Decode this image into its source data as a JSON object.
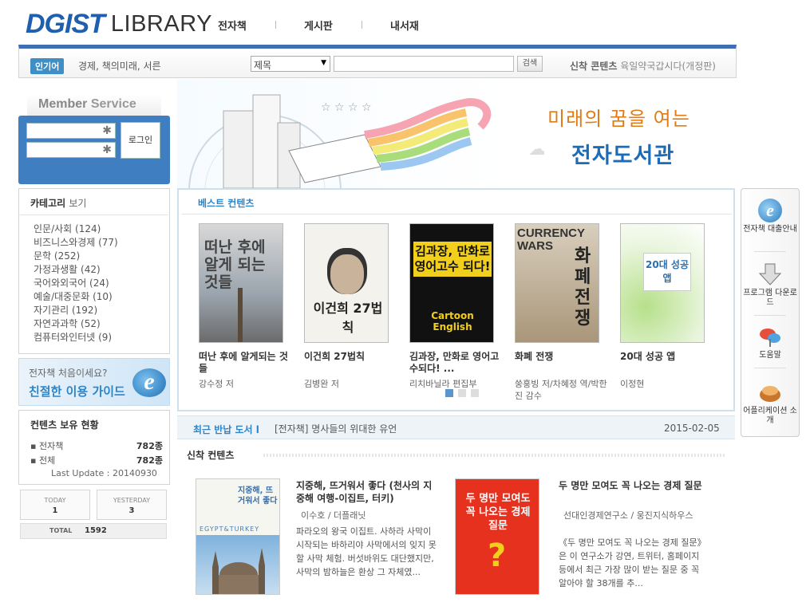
{
  "header": {
    "logo_mark": "DGIST",
    "logo_text": "LIBRARY",
    "nav": [
      "전자책",
      "게시판",
      "내서재"
    ]
  },
  "search_bar": {
    "popular_label": "인기어",
    "popular_words": "경제, 책의미래, 서른",
    "field_option": "제목",
    "search_button": "검색",
    "new_content_label": "신착 콘텐츠",
    "new_content_title": "육일약국갑시다(개정판)"
  },
  "member": {
    "title_a": "Member",
    "title_b": "Service",
    "login_button": "로그인"
  },
  "category": {
    "title": "카테고리",
    "title_suffix": "보기",
    "items": [
      "인문/사회 (124)",
      "비즈니스와경제 (77)",
      "문학 (252)",
      "가정과생활 (42)",
      "국어와외국어 (24)",
      "예술/대중문화 (10)",
      "자기관리 (192)",
      "자연과과학 (52)",
      "컴퓨터와인터넷 (9)"
    ]
  },
  "guide": {
    "line1": "전자책 처음이세요?",
    "line2": "친절한 이용 가이드",
    "icon": "e"
  },
  "holdings": {
    "title": "컨텐츠 보유 현황",
    "rows": [
      {
        "label": "전자책",
        "value": "782종"
      },
      {
        "label": "전체",
        "value": "782종"
      }
    ],
    "last_update": "Last Update : 20140930"
  },
  "stats": {
    "today_label": "TODAY",
    "today_value": "1",
    "yesterday_label": "YESTERDAY",
    "yesterday_value": "3",
    "total_label": "TOTAL",
    "total_value": "1592"
  },
  "banner": {
    "line1": "미래의 꿈을 여는",
    "line2": "전자도서관"
  },
  "best": {
    "title": "베스트 컨텐츠",
    "items": [
      {
        "title": "떠난 후에 알게되는 것들",
        "author": "강수정 저",
        "cover_text": "떠난 후에 알게 되는 것들"
      },
      {
        "title": "이건희 27법칙",
        "author": "김병완 저",
        "cover_text": "이건희 27법칙"
      },
      {
        "title": "김과장, 만화로 영어고수되다! ...",
        "author": "리치바닐라 편집부",
        "cover_text": "김과장, 만화로 영어고수 되다!",
        "cover_sub": "Cartoon English"
      },
      {
        "title": "화폐 전쟁",
        "author": "쑹훙빙 저/차혜정 역/박한진 감수",
        "cover_text": "화폐전쟁",
        "cover_sub": "CURRENCY WARS"
      },
      {
        "title": "20대 성공 앱",
        "author": "이정현",
        "cover_text": "20대 성공앱"
      }
    ],
    "page_count": 3,
    "active_page": 0
  },
  "quick_menu": [
    {
      "label": "전자책 대출안내",
      "icon": "ie-icon"
    },
    {
      "label": "프로그램 다운로드",
      "icon": "download-arrow-icon"
    },
    {
      "label": "도움말",
      "icon": "help-icon"
    },
    {
      "label": "어플리케이션 소개",
      "icon": "app-icon"
    }
  ],
  "recent_return": {
    "label": "최근 반납 도서 l",
    "title": "[전자책] 명사들의 위대한 유언",
    "date": "2015-02-05"
  },
  "new_content": {
    "title": "신착 컨텐츠",
    "items": [
      {
        "title": "지중해, 뜨거워서 좋다 (천사의 지중해 여행-이집트, 터키)",
        "author": "이수호 / 더플래닛",
        "desc": "파라오의 왕국 이집트. 사하라 사막이 시작되는 바하리야 사막에서의 잊지 못할 사막 체험. 버섯바위도 대단했지만, 사막의 밤하늘은 환상 그 자체였...",
        "cover_text": "지중해, 뜨거워서 좋다",
        "cover_sub": "EGYPT&TURKEY"
      },
      {
        "title": "두 명만 모여도 꼭 나오는 경제 질문",
        "author": "선대인경제연구소 / 웅진지식하우스",
        "desc": "《두 명만 모여도 꼭 나오는 경제 질문》은 이 연구소가 강연, 트위터, 홈페이지 등에서 최근 가장 많이 받는 질문 중 꼭 알아야 할 38개를 추...",
        "cover_text": "두 명만 모여도 꼭 나오는 경제 질문"
      }
    ]
  },
  "colors": {
    "accent_blue": "#2d85c9",
    "member_blue": "#3f7ec0",
    "header_line": "#3f6fb2",
    "banner_orange": "#e07b16"
  }
}
